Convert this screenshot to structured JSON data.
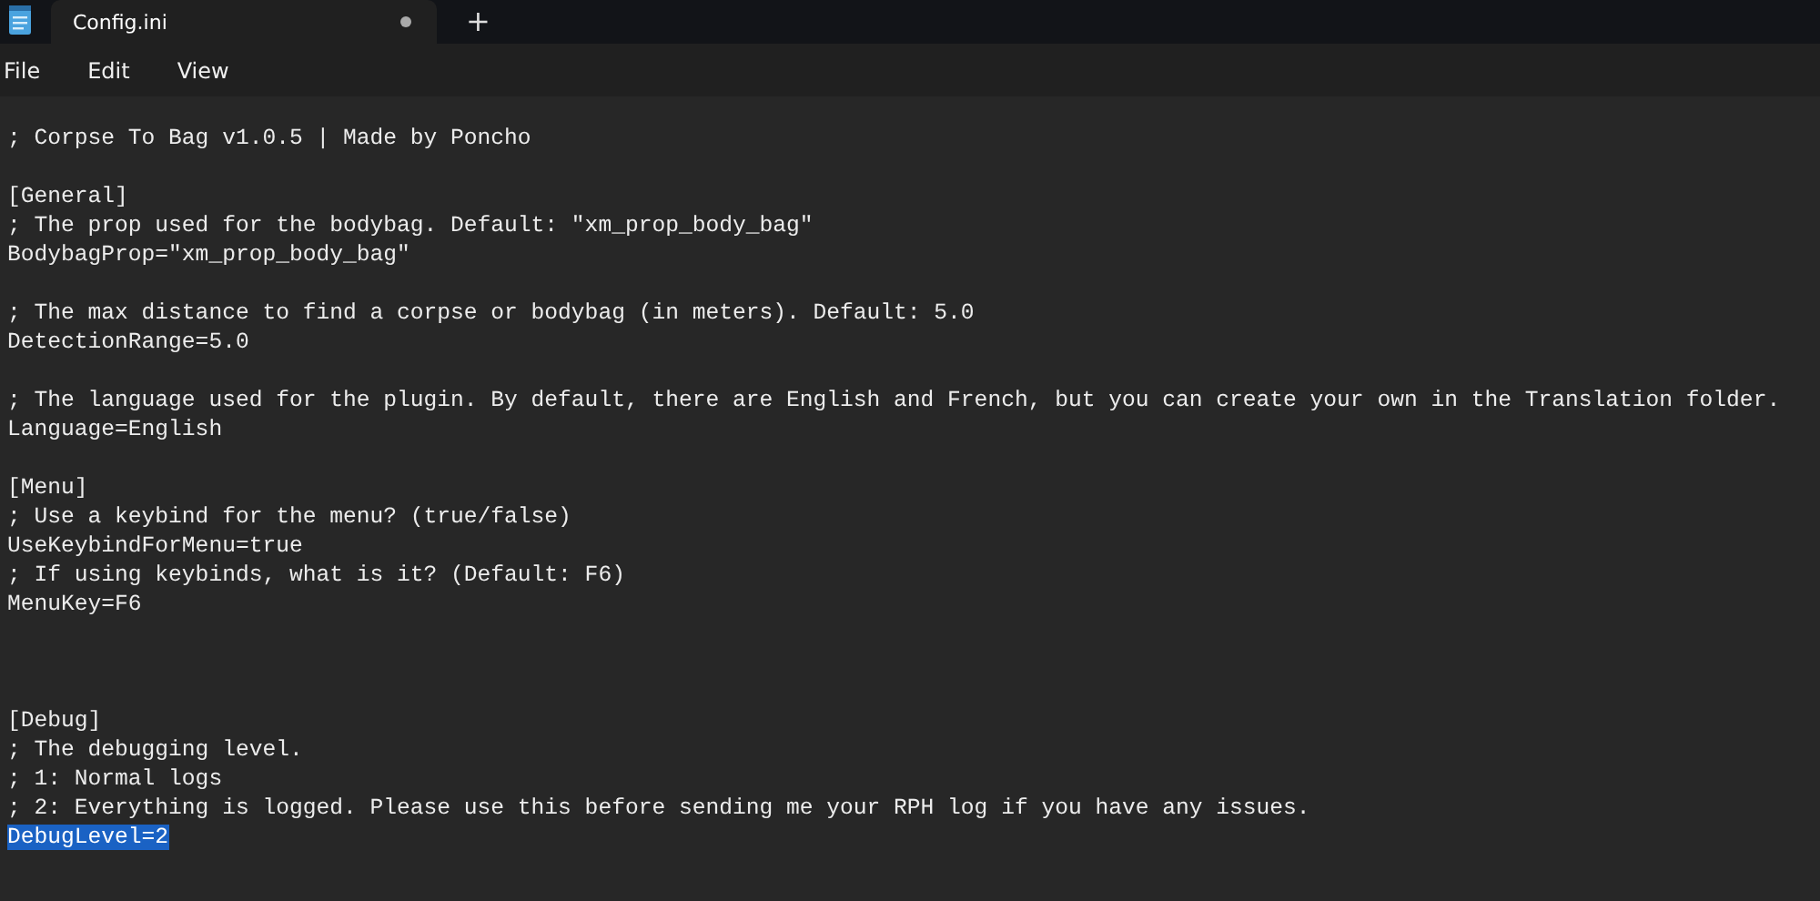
{
  "tabs": [
    {
      "label": "Config.ini",
      "selected": true,
      "modified": true
    }
  ],
  "new_tab": "+",
  "menu": [
    "File",
    "Edit",
    "View"
  ],
  "lines": [
    {
      "kind": "text",
      "text": "; Corpse To Bag v1.0.5 | Made by Poncho",
      "selected": false
    },
    {
      "kind": "blank"
    },
    {
      "kind": "text",
      "text": "[General]",
      "selected": false
    },
    {
      "kind": "text",
      "text": "; The prop used for the bodybag. Default: \"xm_prop_body_bag\"",
      "selected": false
    },
    {
      "kind": "text",
      "text": "BodybagProp=\"xm_prop_body_bag\"",
      "selected": false
    },
    {
      "kind": "blank"
    },
    {
      "kind": "text",
      "text": "; The max distance to find a corpse or bodybag (in meters). Default: 5.0",
      "selected": false
    },
    {
      "kind": "text",
      "text": "DetectionRange=5.0",
      "selected": false
    },
    {
      "kind": "blank"
    },
    {
      "kind": "text",
      "text": "; The language used for the plugin. By default, there are English and French, but you can create your own in the Translation folder.",
      "selected": false
    },
    {
      "kind": "text",
      "text": "Language=English",
      "selected": false
    },
    {
      "kind": "blank"
    },
    {
      "kind": "text",
      "text": "[Menu]",
      "selected": false
    },
    {
      "kind": "text",
      "text": "; Use a keybind for the menu? (true/false)",
      "selected": false
    },
    {
      "kind": "text",
      "text": "UseKeybindForMenu=true",
      "selected": false
    },
    {
      "kind": "text",
      "text": "; If using keybinds, what is it? (Default: F6)",
      "selected": false
    },
    {
      "kind": "text",
      "text": "MenuKey=F6",
      "selected": false
    },
    {
      "kind": "blank"
    },
    {
      "kind": "blank"
    },
    {
      "kind": "blank"
    },
    {
      "kind": "text",
      "text": "[Debug]",
      "selected": false
    },
    {
      "kind": "text",
      "text": "; The debugging level.",
      "selected": false
    },
    {
      "kind": "text",
      "text": "; 1: Normal logs",
      "selected": false
    },
    {
      "kind": "text",
      "text": "; 2: Everything is logged. Please use this before sending me your RPH log if you have any issues.",
      "selected": false
    },
    {
      "kind": "text",
      "text": "DebugLevel=2",
      "selected": true
    }
  ]
}
